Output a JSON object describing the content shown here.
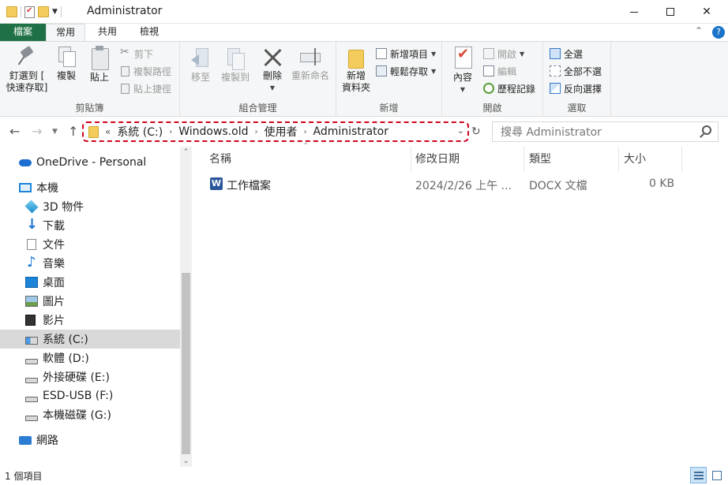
{
  "window": {
    "title": "Administrator"
  },
  "ribbon_tabs": [
    {
      "label": "檔案"
    },
    {
      "label": "常用"
    },
    {
      "label": "共用"
    },
    {
      "label": "檢視"
    }
  ],
  "ribbon": {
    "clipboard": {
      "group_label": "剪貼簿",
      "pin_label_1": "釘選到 [",
      "pin_label_2": "快速存取]",
      "copy": "複製",
      "paste": "貼上",
      "cut": "剪下",
      "copy_path": "複製路徑",
      "paste_shortcut": "貼上捷徑"
    },
    "organize": {
      "group_label": "組合管理",
      "move_to": "移至",
      "copy_to": "複製到",
      "delete": "刪除",
      "rename": "重新命名"
    },
    "new": {
      "group_label": "新增",
      "new_folder_1": "新增",
      "new_folder_2": "資料夾",
      "new_item": "新增項目",
      "easy_access": "輕鬆存取"
    },
    "open": {
      "group_label": "開啟",
      "properties": "內容",
      "open": "開啟",
      "edit": "編輯",
      "history": "歷程記錄"
    },
    "select": {
      "group_label": "選取",
      "select_all": "全選",
      "select_none": "全部不選",
      "invert": "反向選擇"
    }
  },
  "address": {
    "overflow": "«",
    "crumbs": [
      "系統 (C:)",
      "Windows.old",
      "使用者",
      "Administrator"
    ]
  },
  "search": {
    "placeholder": "搜尋 Administrator"
  },
  "nav": {
    "onedrive": "OneDrive - Personal",
    "this_pc": "本機",
    "items": [
      {
        "label": "3D 物件",
        "icon": "3d-objects-icon"
      },
      {
        "label": "下載",
        "icon": "downloads-icon"
      },
      {
        "label": "文件",
        "icon": "documents-icon"
      },
      {
        "label": "音樂",
        "icon": "music-icon"
      },
      {
        "label": "桌面",
        "icon": "desktop-icon"
      },
      {
        "label": "圖片",
        "icon": "pictures-icon"
      },
      {
        "label": "影片",
        "icon": "videos-icon"
      },
      {
        "label": "系統 (C:)",
        "icon": "system-drive-icon"
      },
      {
        "label": "軟體 (D:)",
        "icon": "drive-icon"
      },
      {
        "label": "外接硬碟 (E:)",
        "icon": "drive-icon"
      },
      {
        "label": "ESD-USB (F:)",
        "icon": "drive-icon"
      },
      {
        "label": "本機磁碟 (G:)",
        "icon": "drive-icon"
      }
    ],
    "network": "網路"
  },
  "columns": [
    "名稱",
    "修改日期",
    "類型",
    "大小"
  ],
  "files": [
    {
      "name": "工作檔案",
      "modified": "2024/2/26 上午 ...",
      "type": "DOCX 文檔",
      "size": "0 KB",
      "icon": "word-doc-icon"
    }
  ],
  "status": {
    "item_count": "1 個項目"
  },
  "colors": {
    "file_tab": "#1f7145",
    "selection": "#d9d9d9",
    "highlight_border": "#d0021b"
  }
}
